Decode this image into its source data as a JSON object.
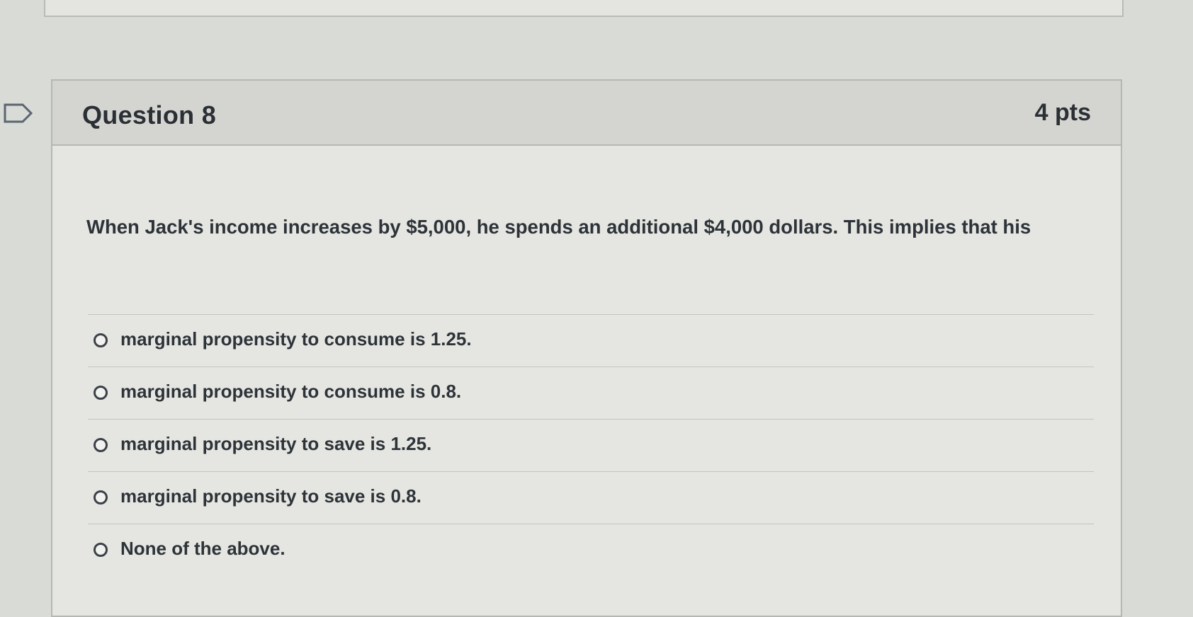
{
  "question": {
    "title": "Question 8",
    "points": "4 pts",
    "text": "When Jack's income increases by $5,000, he spends an additional $4,000 dollars. This implies that his",
    "answers": [
      {
        "label": "marginal propensity to consume is 1.25."
      },
      {
        "label": "marginal propensity to consume is 0.8."
      },
      {
        "label": "marginal propensity to save is 1.25."
      },
      {
        "label": "marginal propensity to save is 0.8."
      },
      {
        "label": "None of the above."
      }
    ]
  },
  "icons": {
    "flag": "flag-question-icon",
    "radio": "radio-button-unselected"
  },
  "colors": {
    "background": "#d9dbd6",
    "card": "#e5e6e2",
    "header": "#d4d5d1",
    "text": "#2d3338"
  }
}
